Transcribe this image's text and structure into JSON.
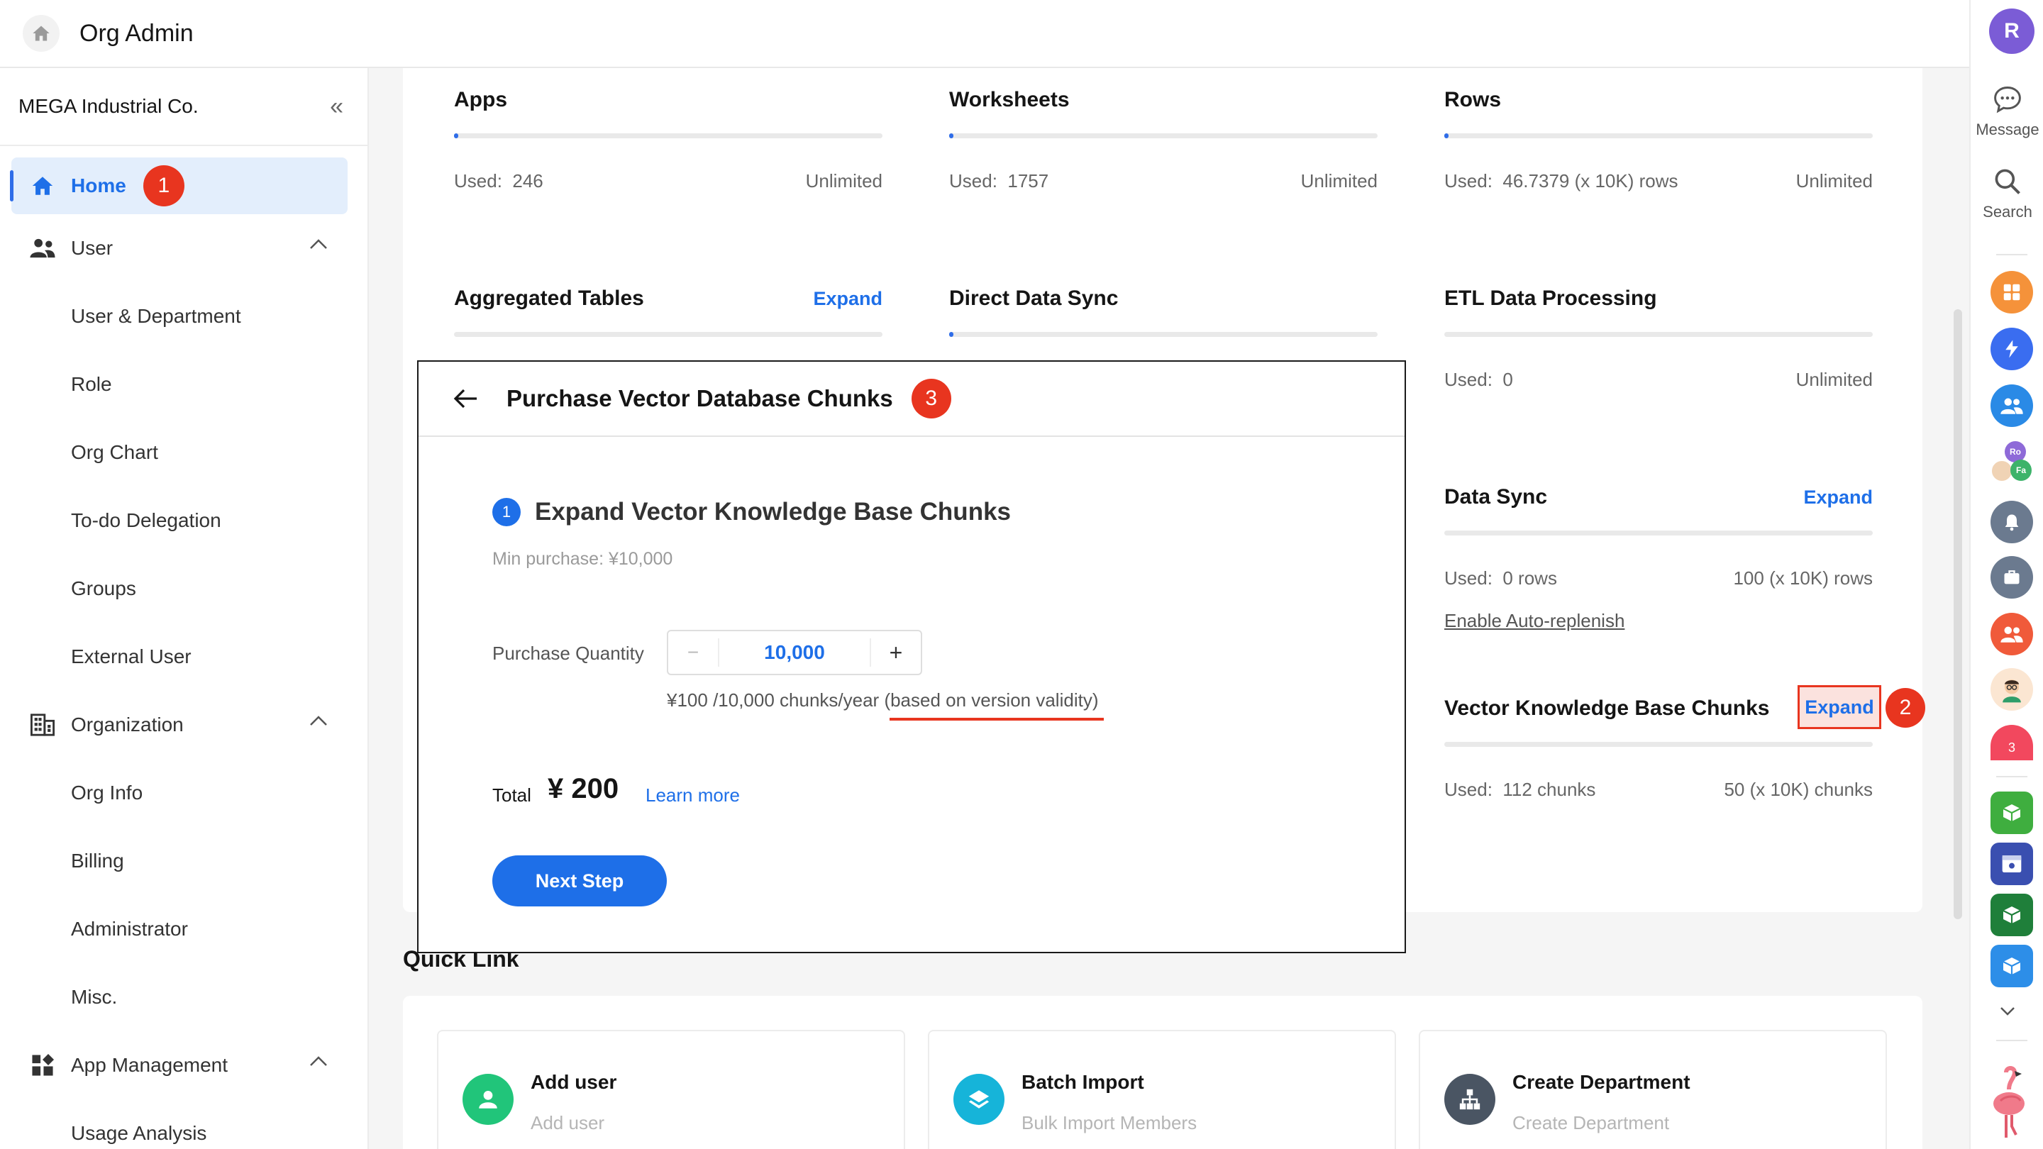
{
  "header": {
    "title": "Org Admin"
  },
  "sidebar": {
    "org_name": "MEGA Industrial Co.",
    "home": {
      "label": "Home",
      "badge": "1"
    },
    "user_group": {
      "label": "User",
      "items": [
        "User & Department",
        "Role",
        "Org Chart",
        "To-do Delegation",
        "Groups",
        "External User"
      ]
    },
    "org_group": {
      "label": "Organization",
      "items": [
        "Org Info",
        "Billing",
        "Administrator",
        "Misc."
      ]
    },
    "app_group": {
      "label": "App Management",
      "items": [
        "Usage Analysis"
      ]
    }
  },
  "quotas": {
    "apps": {
      "title": "Apps",
      "used_label": "Used:",
      "used_value": "246",
      "limit": "Unlimited",
      "used_fraction": 0.01
    },
    "worksheets": {
      "title": "Worksheets",
      "used_label": "Used:",
      "used_value": "1757",
      "limit": "Unlimited",
      "used_fraction": 0.01
    },
    "rows": {
      "title": "Rows",
      "used_label": "Used:",
      "used_value": "46.7379 (x 10K) rows",
      "limit": "Unlimited",
      "used_fraction": 0.01
    },
    "aggregated": {
      "title": "Aggregated Tables",
      "expand": "Expand"
    },
    "direct_sync": {
      "title": "Direct Data Sync",
      "used_fraction": 0.01
    },
    "etl": {
      "title": "ETL Data Processing",
      "used_label": "Used:",
      "used_value": "0",
      "limit": "Unlimited",
      "used_fraction": 0
    },
    "data_sync": {
      "title": "Data Sync",
      "expand": "Expand",
      "used_label": "Used:",
      "used_value": "0 rows",
      "limit": "100 (x 10K) rows",
      "link": "Enable Auto-replenish",
      "used_fraction": 0
    },
    "vector": {
      "title": "Vector Knowledge Base Chunks",
      "expand": "Expand",
      "badge": "2",
      "used_label": "Used:",
      "used_value": "112 chunks",
      "limit": "50 (x 10K) chunks",
      "used_fraction": 0
    }
  },
  "modal": {
    "title": "Purchase Vector Database Chunks",
    "badge": "3",
    "step_number": "1",
    "step_title": "Expand Vector Knowledge Base Chunks",
    "min_purchase": "Min purchase: ¥10,000",
    "qty_label": "Purchase Quantity",
    "qty_minus": "−",
    "qty_value": "10,000",
    "qty_plus": "+",
    "price_note": "¥100 /10,000 chunks/year (based on version validity)",
    "total_label": "Total",
    "total_value": "¥ 200",
    "learn_more": "Learn more",
    "next_button": "Next Step"
  },
  "quick_link": {
    "title": "Quick Link",
    "items": [
      {
        "name": "Add user",
        "desc": "Add user"
      },
      {
        "name": "Batch Import",
        "desc": "Bulk Import Members"
      },
      {
        "name": "Create Department",
        "desc": "Create Department"
      }
    ]
  },
  "rail": {
    "avatar_letter": "R",
    "message": "Message",
    "search": "Search",
    "mini_avatar_1": "Ro",
    "mini_avatar_2": "Fa",
    "calendar_day": "3"
  },
  "colors": {
    "accent": "#1e6fe8",
    "badge_red": "#e8351f",
    "avatar_purple": "#7b5cd6"
  }
}
